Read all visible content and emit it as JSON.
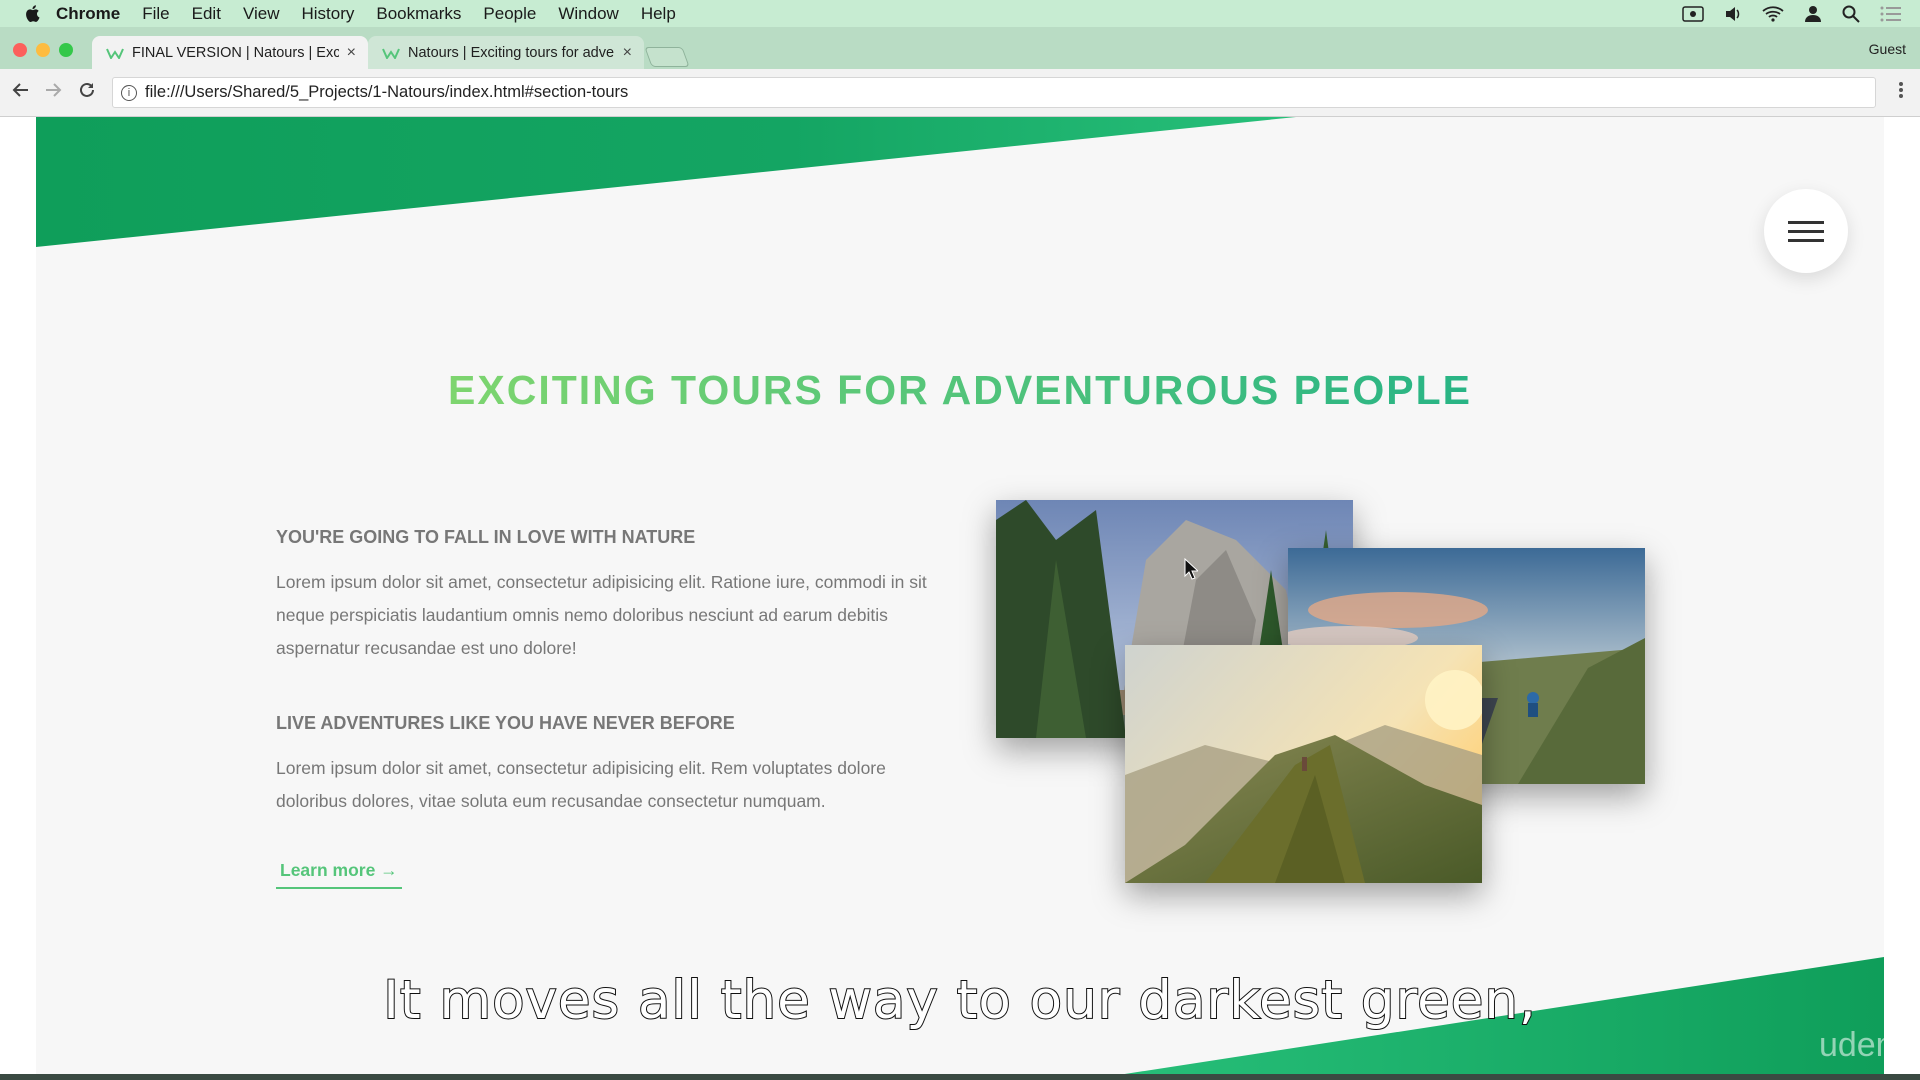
{
  "menubar": {
    "items": [
      "Chrome",
      "File",
      "Edit",
      "View",
      "History",
      "Bookmarks",
      "People",
      "Window",
      "Help"
    ]
  },
  "tabs": [
    {
      "title": "FINAL VERSION | Natours | Exciting tours for adventurous people",
      "close": "×"
    },
    {
      "title": "Natours | Exciting tours for adventurous people",
      "close": "×"
    }
  ],
  "profile": "Guest",
  "address": "file:///Users/Shared/5_Projects/1-Natours/index.html#section-tours",
  "page": {
    "heading": "EXCITING TOURS FOR ADVENTUROUS PEOPLE",
    "block1_title": "YOU'RE GOING TO FALL IN LOVE WITH NATURE",
    "block1_text": "Lorem ipsum dolor sit amet, consectetur adipisicing elit. Ratione iure, commodi in sit neque perspiciatis laudantium omnis nemo doloribus nesciunt ad earum debitis aspernatur recusandae est uno dolore!",
    "block2_title": "LIVE ADVENTURES LIKE YOU HAVE NEVER BEFORE",
    "block2_text": "Lorem ipsum dolor sit amet, consectetur adipisicing elit. Rem voluptates dolore doloribus dolores, vitae soluta eum recusandae consectetur numquam.",
    "link": "Learn more →"
  },
  "caption": "It moves all the way to our darkest green,",
  "watermark": "udem",
  "colors": {
    "green_light": "#7ed56f",
    "green_dark": "#28b485",
    "green_darkest": "#0f9e5a",
    "text_grey": "#777777"
  }
}
